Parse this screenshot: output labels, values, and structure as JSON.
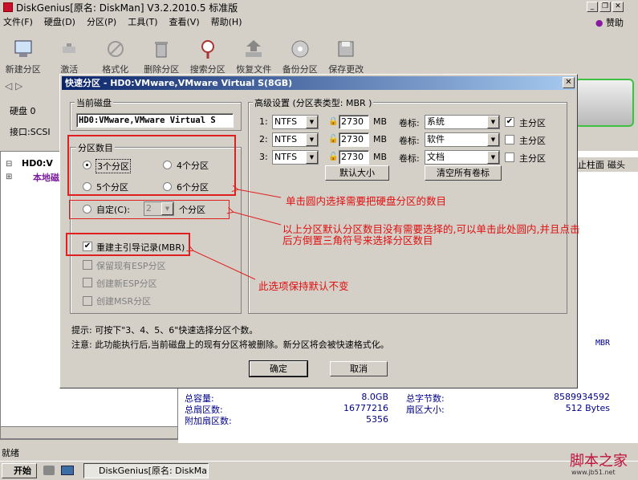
{
  "app": {
    "title": "DiskGenius[原名: DiskMan] V3.2.2010.5 标准版",
    "sponsor": "赞助",
    "menu": [
      "文件(F)",
      "硬盘(D)",
      "分区(P)",
      "工具(T)",
      "查看(V)",
      "帮助(H)"
    ],
    "toolbar": [
      {
        "label": "新建分区",
        "icon": "new-partition-icon"
      },
      {
        "label": "激活",
        "icon": "activate-icon"
      },
      {
        "label": "格式化",
        "icon": "format-icon"
      },
      {
        "label": "删除分区",
        "icon": "delete-partition-icon"
      },
      {
        "label": "搜索分区",
        "icon": "search-partition-icon"
      },
      {
        "label": "恢复文件",
        "icon": "recover-file-icon"
      },
      {
        "label": "备份分区",
        "icon": "backup-partition-icon"
      },
      {
        "label": "保存更改",
        "icon": "save-changes-icon"
      }
    ],
    "disk_label": "硬盘 0",
    "interface": "接口:SCSI",
    "tree": {
      "node1": "HD0:V",
      "node2": "本地磁"
    },
    "right_headers": [
      "止柱面",
      "磁头"
    ],
    "mbr": "MBR",
    "stats": {
      "total_capacity_label": "总容量:",
      "total_capacity": "8.0GB",
      "total_sectors_label": "总扇区数:",
      "total_sectors": "16777216",
      "extra_sectors_label": "附加扇区数:",
      "extra_sectors": "5356",
      "total_bytes_label": "总字节数:",
      "total_bytes": "8589934592",
      "sector_size_label": "扇区大小:",
      "sector_size": "512 Bytes"
    },
    "status": "就绪",
    "taskbar": {
      "start": "开始",
      "item": "DiskGenius[原名: DiskMa..."
    },
    "watermark": "脚本之家",
    "watermark_url": "www.jb51.net"
  },
  "dialog": {
    "title": "快速分区 - HD0:VMware,VMware Virtual S(8GB)",
    "current_disk_label": "当前磁盘",
    "current_disk_value": "HD0:VMware,VMware Virtual S",
    "partition_count_label": "分区数目",
    "options": [
      "3个分区",
      "4个分区",
      "5个分区",
      "6个分区"
    ],
    "custom_label": "自定(C):",
    "custom_value": "2",
    "custom_unit": "个分区",
    "rebuild_mbr": "重建主引导记录(MBR)",
    "keep_esp": "保留现有ESP分区",
    "create_esp": "创建新ESP分区",
    "create_msr": "创建MSR分区",
    "advanced_label": "高级设置 (分区表类型: MBR )",
    "rows": [
      {
        "no": "1:",
        "fs": "NTFS",
        "size": "2730",
        "unit": "MB",
        "vol_label": "卷标:",
        "vol": "系统",
        "primary": "主分区",
        "checked": true
      },
      {
        "no": "2:",
        "fs": "NTFS",
        "size": "2730",
        "unit": "MB",
        "vol_label": "卷标:",
        "vol": "软件",
        "primary": "主分区",
        "checked": false
      },
      {
        "no": "3:",
        "fs": "NTFS",
        "size": "2730",
        "unit": "MB",
        "vol_label": "卷标:",
        "vol": "文档",
        "primary": "主分区",
        "checked": false
      }
    ],
    "default_size_btn": "默认大小",
    "clear_labels_btn": "清空所有卷标",
    "hint1": "提示: 可按下\"3、4、5、6\"快速选择分区个数。",
    "hint2": "注意: 此功能执行后,当前磁盘上的现有分区将被删除。新分区将会被快速格式化。",
    "ok": "确定",
    "cancel": "取消"
  },
  "annotations": {
    "a1": "单击圆内选择需要把硬盘分区的数目",
    "a2": "以上分区默认分区数目没有需要选择的,可以单击此处圆内,并且点击",
    "a3": "后方倒置三角符号来选择分区数目",
    "a4": "此选项保持默认不变"
  },
  "colors": {
    "title_gradient_start": "#0a246a",
    "annotation": "#e02020",
    "tree_node2": "#7a1ca0"
  }
}
